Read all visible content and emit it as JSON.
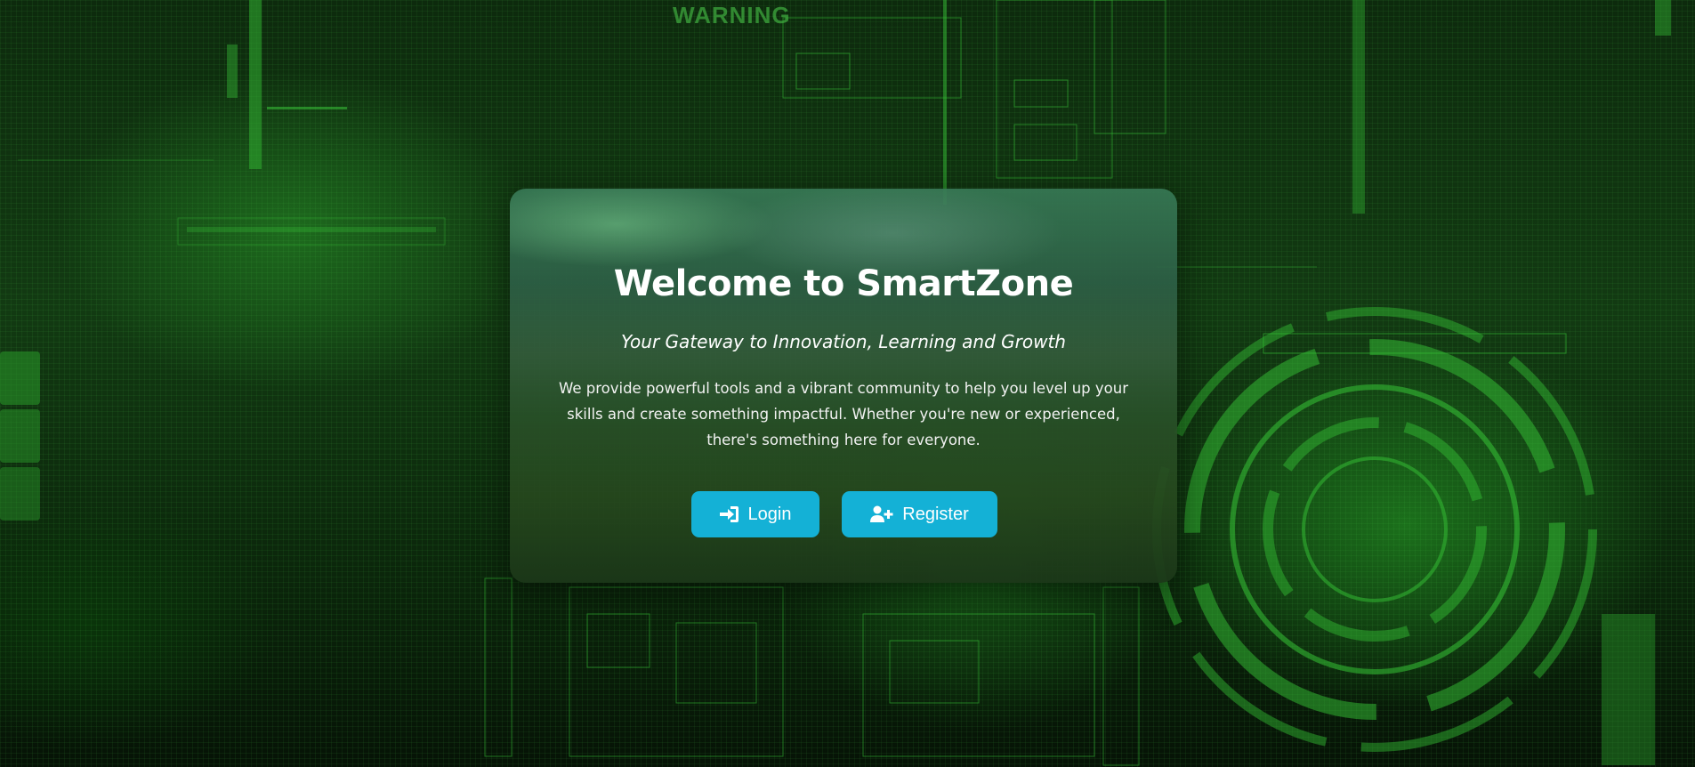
{
  "background": {
    "watermark_text": "WARNING",
    "accent_color": "#33cc33"
  },
  "card": {
    "title": "Welcome to SmartZone",
    "subtitle": "Your Gateway to Innovation, Learning and Growth",
    "description": "We provide powerful tools and a vibrant community to help you level up your skills and create something impactful. Whether you're new or experienced, there's something here for everyone.",
    "buttons": {
      "login": {
        "label": "Login",
        "icon": "sign-in-icon"
      },
      "register": {
        "label": "Register",
        "icon": "user-plus-icon"
      }
    },
    "button_color": "#14b1d6"
  }
}
